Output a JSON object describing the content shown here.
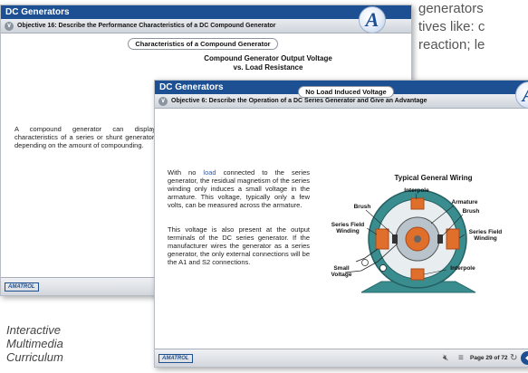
{
  "background_text": [
    "generators",
    "tives like: c",
    "reaction; le"
  ],
  "window1": {
    "title": "DC Generators",
    "objective": "Objective 16: Describe the Performance Characteristics of a DC Compound Generator",
    "section_title": "Characteristics of a Compound Generator",
    "chart_title_1": "Compound Generator Output Voltage",
    "chart_title_2": "vs. Load Resistance",
    "body": "A compound generator can display characteristics of a series or shunt generator, depending on the amount of compounding.",
    "footer_logo": "AMATROL"
  },
  "window2": {
    "title": "DC Generators",
    "objective": "Objective 6: Describe the Operation of a DC Series Generator and Give an Advantage",
    "section_title": "No Load Induced Voltage",
    "para1_pre": "With no ",
    "para1_link": "load",
    "para1_post": " connected to the series generator, the residual magnetism of the series winding only induces a small voltage in the armature. This voltage, typically only a few volts, can be measured across the armature.",
    "para2": "This voltage is also present at the output terminals of the DC series generator. If the manufacturer wires the generator as a series generator, the only external connections will be the A1 and S2 connections.",
    "diagram": {
      "title": "Typical General Wiring",
      "labels": {
        "interpole_top": "Interpole",
        "armature": "Armature",
        "brush_left": "Brush",
        "brush_right": "Brush",
        "series_field_left_1": "Series Field",
        "series_field_left_2": "Winding",
        "series_field_right_1": "Series Field",
        "series_field_right_2": "Winding",
        "interpole_bottom": "Interpole",
        "small_voltage_1": "Small",
        "small_voltage_2": "Voltage"
      }
    },
    "footer_logo": "AMATROL",
    "page_info": "Page 29 of 72"
  },
  "caption": [
    "Interactive",
    "Multimedia",
    "Curriculum"
  ],
  "icons": [
    "chevron-down-icon",
    "amatrol-a-logo-icon",
    "mute-icon",
    "menu-icon",
    "refresh-icon",
    "previous-arrow-icon",
    "next-arrow-icon"
  ],
  "colors": {
    "title_bar": "#1d4f93",
    "link": "#1f5fd6",
    "copper": "#e06f2c",
    "teal": "#3a8d8f"
  }
}
